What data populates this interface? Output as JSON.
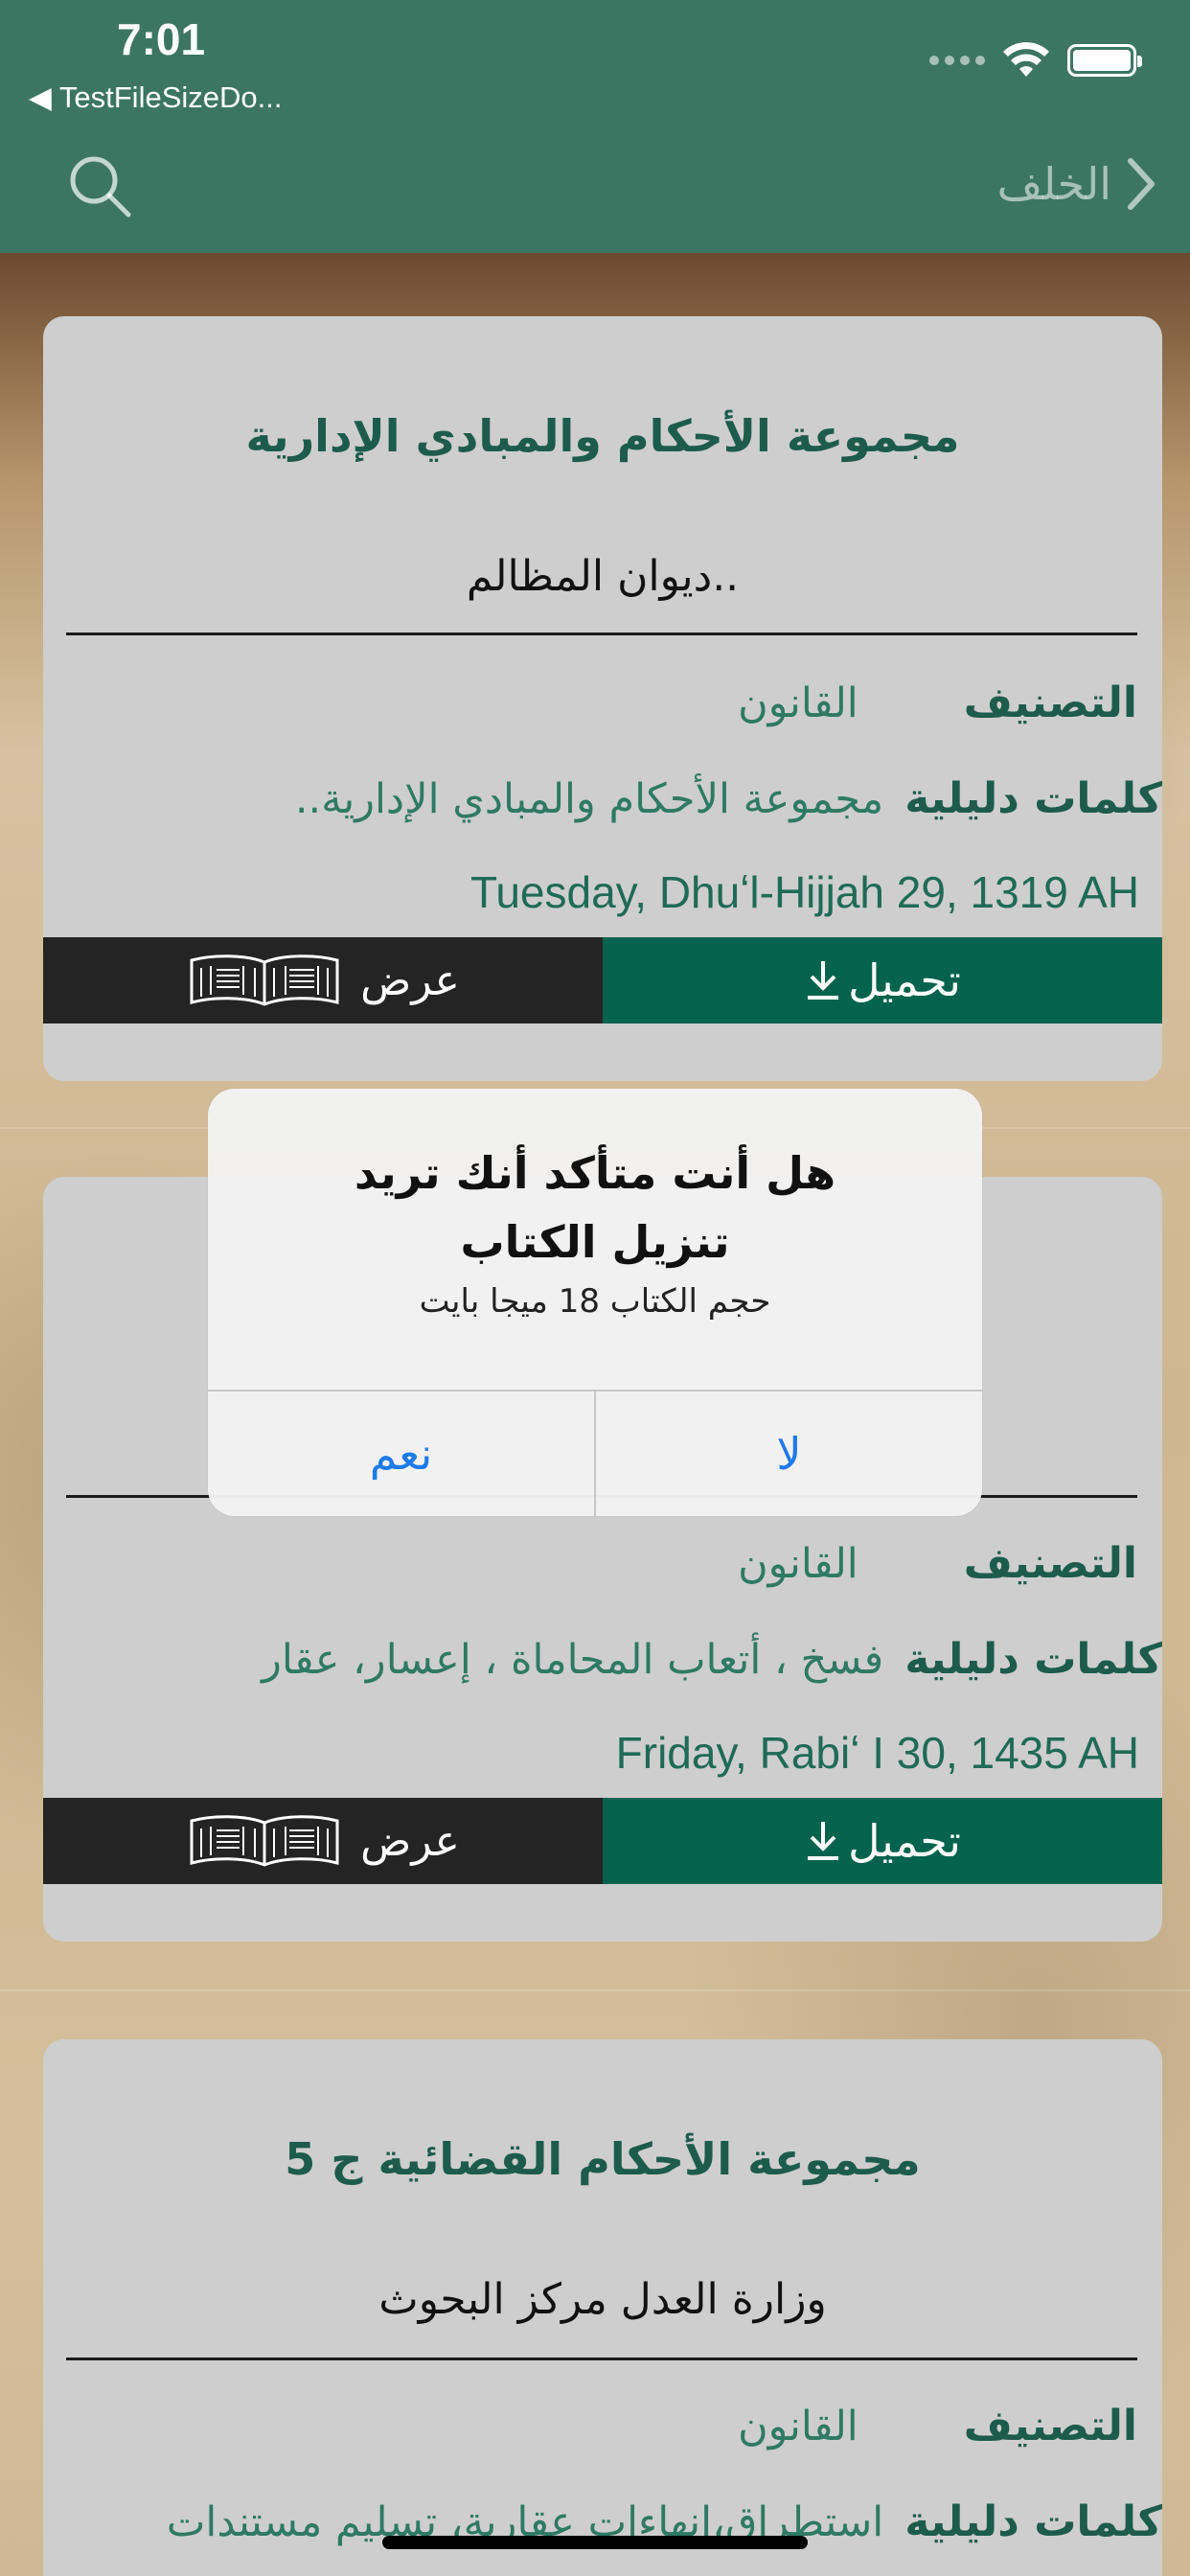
{
  "status_bar": {
    "time": "7:01",
    "back_app": "◀ TestFileSizeDo..."
  },
  "nav": {
    "back_label": "الخلف",
    "icons": {
      "search": "search-icon",
      "back": "chevron-right-icon"
    }
  },
  "labels": {
    "category": "التصنيف",
    "keywords": "كلمات دليلية",
    "view": "عرض",
    "download": "تحميل"
  },
  "cards": [
    {
      "title": "مجموعة الأحكام والمبادي الإدارية",
      "author": "ديوان المظالم..",
      "category": "القانون",
      "keywords": "مجموعة الأحكام والمبادي الإدارية..",
      "date": "Tuesday, Dhuʻl-Hijjah 29, 1319 AH"
    },
    {
      "title": "",
      "author": "",
      "category": "القانون",
      "keywords": "فسخ ، أتعاب المحاماة ، إعسار، عقار",
      "date": "Friday, Rabiʻ I 30, 1435 AH"
    },
    {
      "title": "مجموعة الأحكام القضائية ج 5",
      "author": "وزارة العدل مركز البحوث",
      "category": "القانون",
      "keywords": "استطراق،انهاءات عقارية، تسليم مستندات"
    }
  ],
  "alert": {
    "title_line1": "هل أنت متأكد أنك تريد",
    "title_line2": "تنزيل الكتاب",
    "message": "حجم الكتاب  18 ميجا بايت",
    "yes": "نعم",
    "no": "لا"
  },
  "colors": {
    "nav_bg": "#3c7663",
    "accent_green": "#04634d",
    "title_green": "#1d5c4c",
    "alert_button_blue": "#1e7bea",
    "view_button_bg": "#242424"
  }
}
